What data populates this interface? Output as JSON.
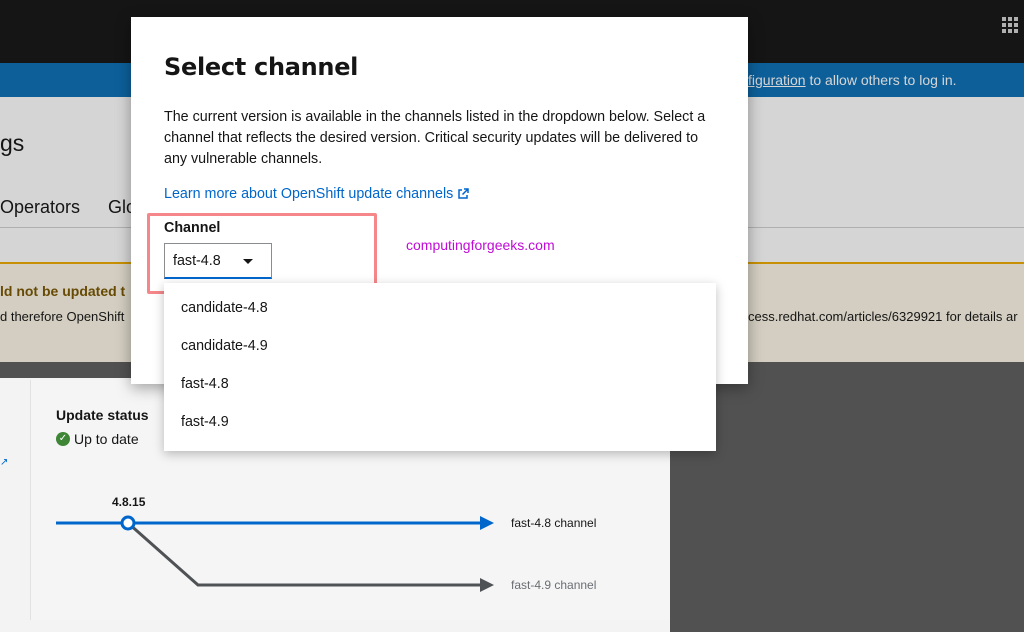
{
  "banner": {
    "link_text": "figuration",
    "text": " to allow others to log in."
  },
  "background": {
    "page_title": "gs",
    "tabs": [
      "Operators",
      "Glo"
    ],
    "alert_title": "ld not be updated t",
    "alert_body": "d therefore OpenShift",
    "alert_url": "cess.redhat.com/articles/6329921 for details ar"
  },
  "update_status": {
    "label": "Update status",
    "value": "Up to date",
    "current_version": "4.8.15",
    "channels": [
      "fast-4.8 channel",
      "fast-4.9 channel"
    ],
    "colors": {
      "active_channel": "#0066cc",
      "other_channel": "#4f5255"
    }
  },
  "modal": {
    "title": "Select channel",
    "description": "The current version is available in the channels listed in the dropdown below. Select a channel that reflects the desired version. Critical security updates will be delivered to any vulnerable channels.",
    "learn_more": "Learn more about OpenShift update channels",
    "field_label": "Channel",
    "selected": "fast-4.8",
    "options": [
      "candidate-4.8",
      "candidate-4.9",
      "fast-4.8",
      "fast-4.9"
    ]
  },
  "watermark": "computingforgeeks.com",
  "colors": {
    "link": "#0066cc",
    "highlight": "#f5878a",
    "banner": "#0b6fb8",
    "watermark": "#c00bd6"
  }
}
